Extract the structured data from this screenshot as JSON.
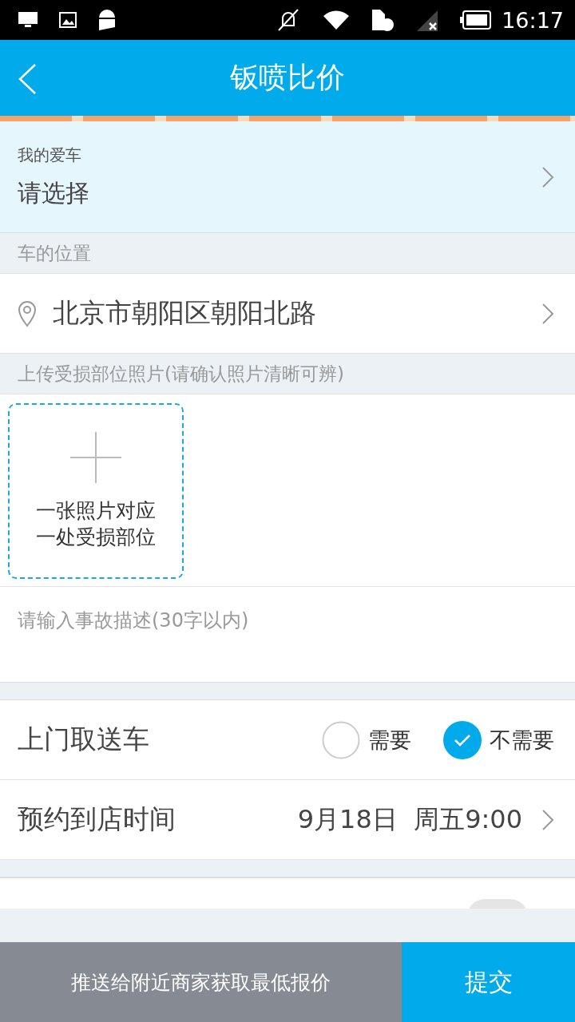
{
  "status_bar": {
    "time": "16:17"
  },
  "header": {
    "title": "钣喷比价"
  },
  "my_car": {
    "label": "我的爱车",
    "value": "请选择"
  },
  "location": {
    "section": "车的位置",
    "address": "北京市朝阳区朝阳北路"
  },
  "photos": {
    "section": "上传受损部位照片(请确认照片清晰可辨)",
    "hint_lines": [
      "一张照片对应",
      "一处受损部位"
    ]
  },
  "description": {
    "placeholder": "请输入事故描述(30字以内)"
  },
  "pickup": {
    "label": "上门取送车",
    "options": [
      {
        "label": "需要",
        "selected": false
      },
      {
        "label": "不需要",
        "selected": true
      }
    ]
  },
  "appointment": {
    "label": "预约到店时间",
    "value": "9月18日  周五9:00"
  },
  "partial_row": {
    "toggle": {
      "on": false
    }
  },
  "bottom_bar": {
    "hint": "推送给附近商家获取最低报价",
    "submit": "提交"
  }
}
